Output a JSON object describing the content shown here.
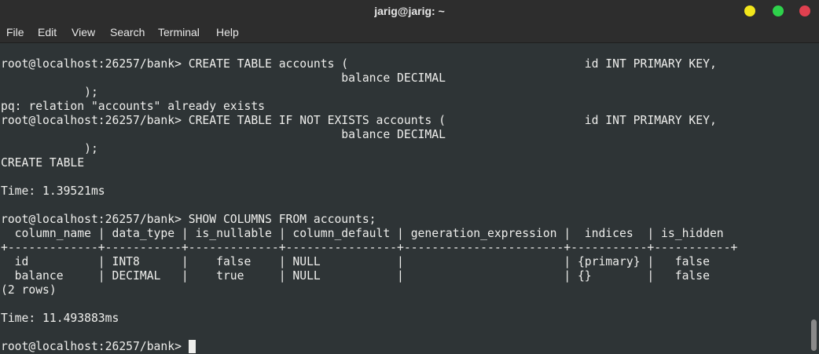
{
  "window": {
    "title": "jarig@jarig: ~",
    "buttons": {
      "minimize_color": "#f2e61b",
      "maximize_color": "#2ed24b",
      "close_color": "#e0404f"
    }
  },
  "menu": [
    "File",
    "Edit",
    "View",
    "Search",
    "Terminal",
    "Help"
  ],
  "terminal": {
    "lines": [
      "root@localhost:26257/bank> CREATE TABLE accounts (                                  id INT PRIMARY KEY,",
      "                                                 balance DECIMAL",
      "            );",
      "pq: relation \"accounts\" already exists",
      "root@localhost:26257/bank> CREATE TABLE IF NOT EXISTS accounts (                    id INT PRIMARY KEY,",
      "                                                 balance DECIMAL",
      "            );",
      "CREATE TABLE",
      "",
      "Time: 1.39521ms",
      "",
      "root@localhost:26257/bank> SHOW COLUMNS FROM accounts;",
      "  column_name | data_type | is_nullable | column_default | generation_expression |  indices  | is_hidden",
      "+-------------+-----------+-------------+----------------+-----------------------+-----------+-----------+",
      "  id          | INT8      |    false    | NULL           |                       | {primary} |   false",
      "  balance     | DECIMAL   |    true     | NULL           |                       | {}        |   false",
      "(2 rows)",
      "",
      "Time: 11.493883ms",
      "",
      "root@localhost:26257/bank> "
    ]
  }
}
